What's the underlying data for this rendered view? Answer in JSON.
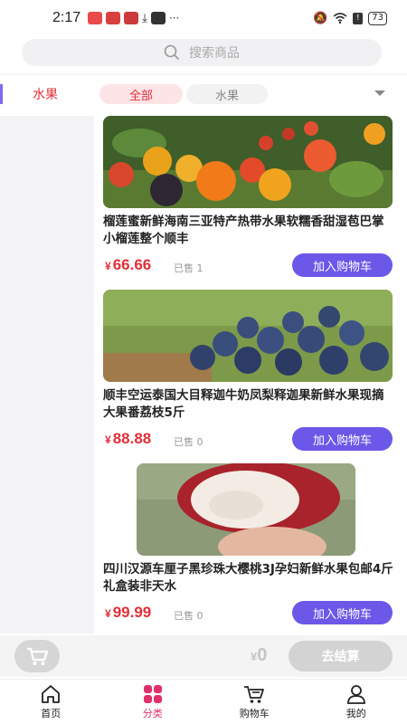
{
  "status_bar": {
    "time": "2:17",
    "dots": "···",
    "battery": "73"
  },
  "search": {
    "placeholder": "搜索商品"
  },
  "filters": {
    "left_category": "水果",
    "chips": [
      {
        "label": "全部"
      },
      {
        "label": "水果"
      }
    ]
  },
  "products": [
    {
      "title": "榴莲蜜新鲜海南三亚特产热带水果软糯香甜湿苞巴掌小榴莲整个顺丰",
      "currency": "¥",
      "price": "66.66",
      "sold": "已售 1",
      "button": "加入购物车"
    },
    {
      "title": "顺丰空运泰国大目释迦牛奶凤梨释迦果新鲜水果现摘大果番荔枝5斤",
      "currency": "¥",
      "price": "88.88",
      "sold": "已售 0",
      "button": "加入购物车"
    },
    {
      "title": "四川汉源车厘子黑珍珠大樱桃3J孕妇新鲜水果包邮4斤礼盒装非天水",
      "currency": "¥",
      "price": "99.99",
      "sold": "已售 0",
      "button": "加入购物车"
    }
  ],
  "cart": {
    "currency": "¥",
    "total": "0",
    "checkout": "去结算"
  },
  "tabbar": [
    {
      "label": "首页",
      "icon": "home-icon"
    },
    {
      "label": "分类",
      "icon": "category-icon"
    },
    {
      "label": "购物车",
      "icon": "cart-icon"
    },
    {
      "label": "我的",
      "icon": "profile-icon"
    }
  ],
  "colors": {
    "accent_red": "#e0303a",
    "button_purple": "#6b57e8",
    "tab_active": "#e0306a"
  }
}
